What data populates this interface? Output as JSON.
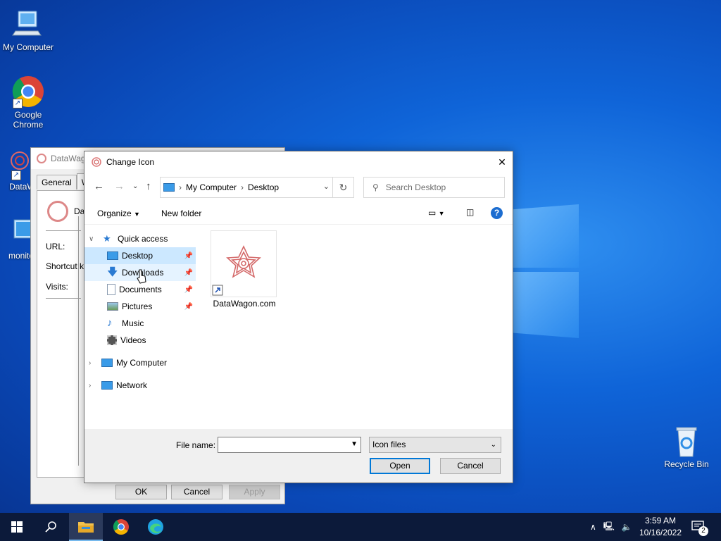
{
  "desktop": {
    "icons": [
      {
        "label": "My Computer"
      },
      {
        "label": "Google Chrome"
      },
      {
        "label": "DataWa"
      },
      {
        "label": "monito"
      },
      {
        "label": "Recycle Bin"
      }
    ]
  },
  "properties_dialog": {
    "title": "DataWag",
    "tabs": [
      "General",
      "We"
    ],
    "icon_label": "Da",
    "fields": {
      "url": "URL:",
      "shortcut_key": "Shortcut k",
      "visits": "Visits:"
    },
    "buttons": {
      "ok": "OK",
      "cancel": "Cancel",
      "apply": "Apply"
    }
  },
  "change_icon_dialog": {
    "title": "Change Icon",
    "close": "✕",
    "breadcrumb": [
      "My Computer",
      "Desktop"
    ],
    "search_placeholder": "Search Desktop",
    "toolbar": {
      "organize": "Organize",
      "new_folder": "New folder",
      "help": "?"
    },
    "nav": {
      "quick_access": "Quick access",
      "items": [
        {
          "label": "Desktop",
          "pinned": true
        },
        {
          "label": "Downloads",
          "pinned": true
        },
        {
          "label": "Documents",
          "pinned": true
        },
        {
          "label": "Pictures",
          "pinned": true
        },
        {
          "label": "Music",
          "pinned": false
        },
        {
          "label": "Videos",
          "pinned": false
        }
      ],
      "my_computer": "My Computer",
      "network": "Network"
    },
    "files": [
      {
        "name": "DataWagon.com"
      }
    ],
    "file_name_label": "File name:",
    "file_name_value": "",
    "file_type": "Icon files",
    "buttons": {
      "open": "Open",
      "cancel": "Cancel"
    }
  },
  "taskbar": {
    "clock_time": "3:59 AM",
    "clock_date": "10/16/2022",
    "notification_count": "2"
  },
  "colors": {
    "selection": "#cce8ff",
    "accent": "#0078d7",
    "taskbar": "#0c1a3a"
  }
}
